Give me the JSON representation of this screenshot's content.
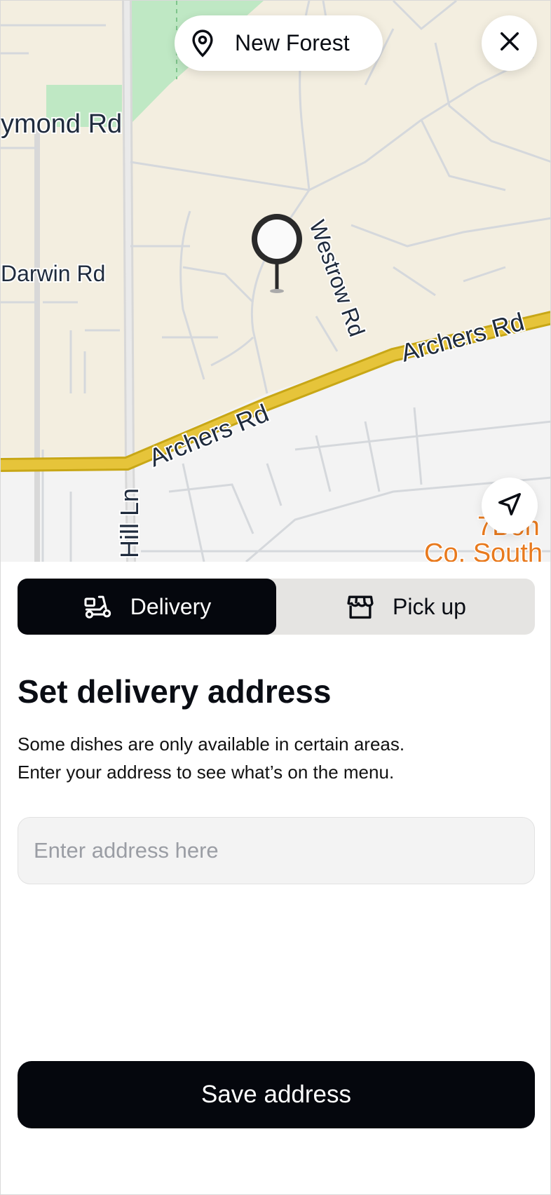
{
  "map": {
    "location_label": "New Forest",
    "street_labels": {
      "raymond": "ymond Rd",
      "darwin": "Darwin Rd",
      "westrow": "Westrow Rd",
      "archers_top": "Archers Rd",
      "archers_bottom": "Archers Rd",
      "hill": "Hill Ln",
      "poi_line1": "7Bon",
      "poi_line2": "Co. South"
    },
    "colors": {
      "land": "#f3eee0",
      "park": "#bfe8c4",
      "main_road": "#e2c236",
      "lower_area": "#f3f3f3"
    }
  },
  "icons": {
    "location": "map-pin-icon",
    "close": "close-icon",
    "locate": "navigation-arrow-icon",
    "delivery": "scooter-icon",
    "pickup": "store-icon"
  },
  "sheet": {
    "tabs": [
      {
        "label": "Delivery",
        "active": true
      },
      {
        "label": "Pick up",
        "active": false
      }
    ],
    "title": "Set delivery address",
    "description_line1": "Some dishes are only available in certain areas.",
    "description_line2": "Enter your address to see what’s on the menu.",
    "address_input": {
      "value": "",
      "placeholder": "Enter address here"
    },
    "save_label": "Save address"
  },
  "colors": {
    "primary": "#05070d",
    "toggle_bg": "#e5e4e2",
    "input_bg": "#f3f3f3"
  }
}
